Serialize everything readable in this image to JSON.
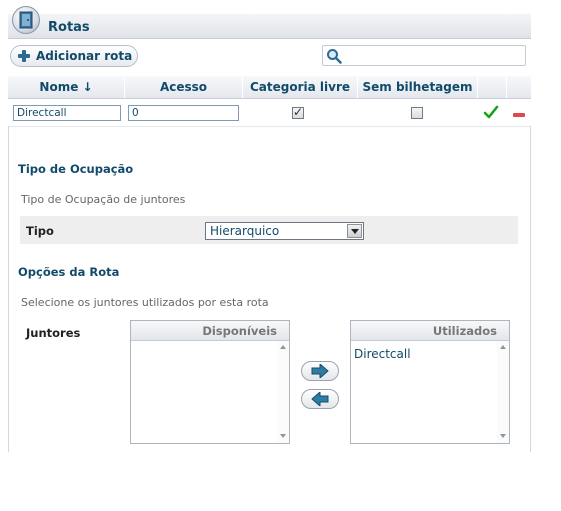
{
  "header": {
    "title": "Rotas",
    "title_icon": "door-icon"
  },
  "toolbar": {
    "add_label": "Adicionar rota",
    "search_placeholder": "",
    "search_value": ""
  },
  "table": {
    "columns": [
      "Nome ↓",
      "Acesso",
      "Categoria livre",
      "Sem bilhetagem"
    ],
    "rows": [
      {
        "nome": "Directcall",
        "acesso": "0",
        "categoria_livre": true,
        "sem_bilhetagem": false
      }
    ]
  },
  "ocupacao": {
    "section_title": "Tipo de Ocupação",
    "description": "Tipo de Ocupação de juntores",
    "tipo_label": "Tipo",
    "tipo_value": "Hierarquico"
  },
  "opcoes": {
    "section_title": "Opções da Rota",
    "description": "Selecione os juntores utilizados por esta rota",
    "juntores_label": "Juntores",
    "disponiveis_header": "Disponíveis",
    "disponiveis_items": [],
    "utilizados_header": "Utilizados",
    "utilizados_items": [
      "Directcall"
    ]
  },
  "colors": {
    "accent": "#124a6a",
    "confirm": "#1aa31a",
    "remove": "#e2474b"
  }
}
